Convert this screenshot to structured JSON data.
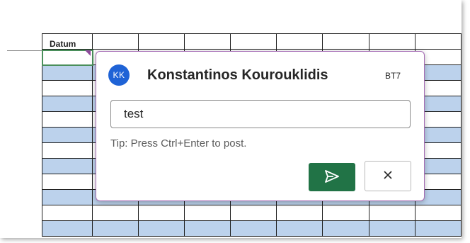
{
  "sheet": {
    "header_label": "Datum",
    "row_pattern": [
      "white",
      "blue",
      "white",
      "blue",
      "white",
      "blue",
      "white",
      "blue",
      "white",
      "blue",
      "white",
      "blue"
    ]
  },
  "comment": {
    "avatar_initials": "KK",
    "author_name": "Konstantinos Kouroukli",
    "author_name_full": "Konstantinos Kourouklidis",
    "cell_reference": "BT7",
    "input_value": "test",
    "tip": "Tip: Press Ctrl+Enter to post.",
    "post_icon": "send-icon",
    "cancel_icon": "close-icon"
  },
  "colors": {
    "accent_purple": "#a56bb4",
    "post_green": "#217346",
    "avatar_blue": "#1f63d6",
    "row_blue": "#bcd2ec"
  }
}
